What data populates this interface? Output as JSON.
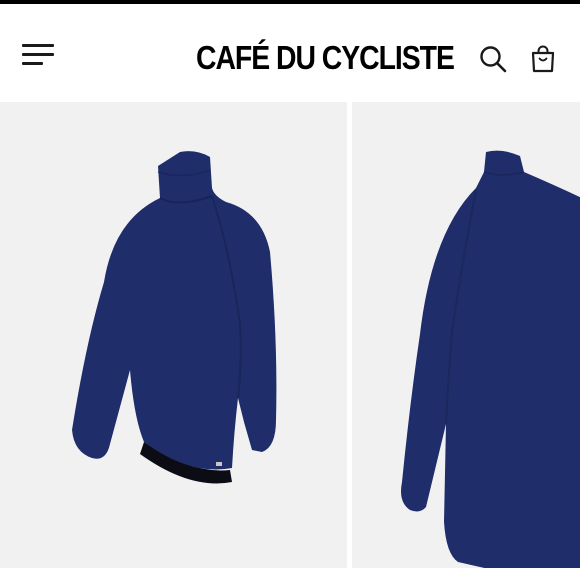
{
  "header": {
    "brand": "CAFÉ DU CYCLISTE",
    "menu_icon": "hamburger-menu-icon",
    "search_icon": "search-icon",
    "bag_icon": "shopping-bag-icon"
  },
  "gallery": {
    "active_index": 0,
    "slides": [
      {
        "view": "front"
      },
      {
        "view": "back"
      }
    ]
  },
  "colors": {
    "accent": "#000000",
    "background": "#ffffff",
    "image_background": "#f1f1f1",
    "garment": "#1f2d6b"
  }
}
